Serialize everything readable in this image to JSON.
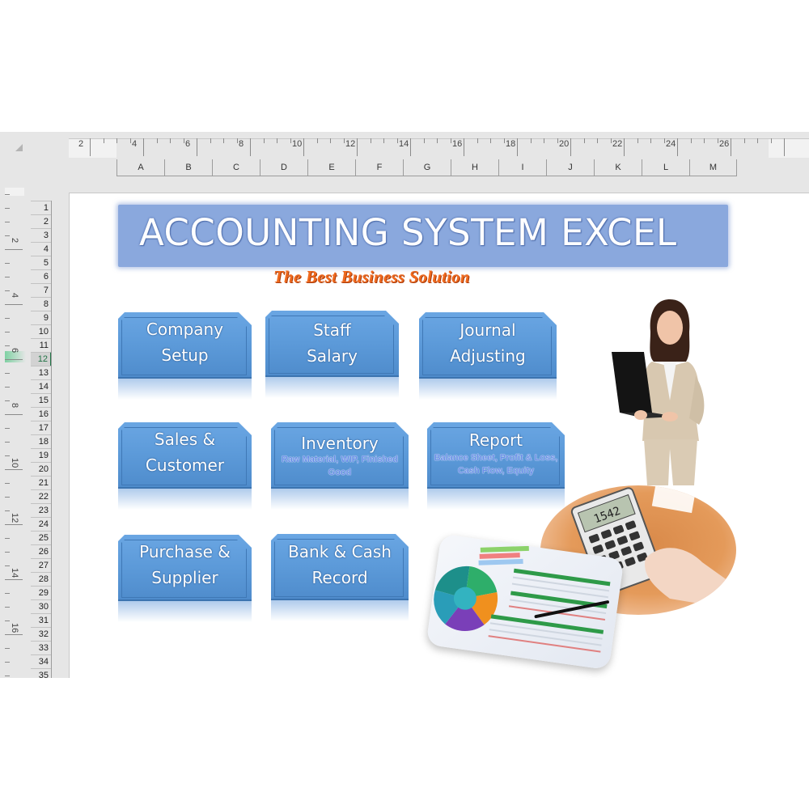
{
  "excel": {
    "ruler_h_labels": [
      "2",
      "4",
      "6",
      "8",
      "10",
      "12",
      "14",
      "16",
      "18",
      "20",
      "22",
      "24",
      "26"
    ],
    "ruler_v_labels": [
      "2",
      "4",
      "6",
      "8",
      "10",
      "12",
      "14",
      "16"
    ],
    "columns": [
      "A",
      "B",
      "C",
      "D",
      "E",
      "F",
      "G",
      "H",
      "I",
      "J",
      "K",
      "L",
      "M"
    ],
    "rows": [
      "1",
      "2",
      "3",
      "4",
      "5",
      "6",
      "7",
      "8",
      "9",
      "10",
      "11",
      "12",
      "13",
      "14",
      "15",
      "16",
      "17",
      "18",
      "19",
      "20",
      "21",
      "22",
      "23",
      "24",
      "25",
      "26",
      "27",
      "28",
      "29",
      "30",
      "31",
      "32",
      "33",
      "34",
      "35"
    ],
    "selected_row": "12",
    "accent_color": "#217346"
  },
  "banner": {
    "title": "ACCOUNTING SYSTEM EXCEL",
    "tagline": "The Best Business Solution"
  },
  "tiles": [
    {
      "line1": "Company",
      "line2": "Setup",
      "sub": ""
    },
    {
      "line1": "Staff",
      "line2": "Salary",
      "sub": ""
    },
    {
      "line1": "Journal",
      "line2": "Adjusting",
      "sub": ""
    },
    {
      "line1": "Sales &",
      "line2": "Customer",
      "sub": ""
    },
    {
      "line1": "Inventory",
      "line2": "",
      "sub": "Raw Material, WIP, Finished Good"
    },
    {
      "line1": "Report",
      "line2": "",
      "sub": "Balance Sheet, Profit & Loss, Cash Flow, Equity"
    },
    {
      "line1": "Purchase &",
      "line2": "Supplier",
      "sub": ""
    },
    {
      "line1": "Bank & Cash",
      "line2": "Record",
      "sub": ""
    }
  ],
  "images": {
    "person": "businesswoman-with-laptop",
    "calculator": "hand-using-calculator",
    "calculator_display": "1542",
    "report": "financial-report-with-pie-chart"
  },
  "colors": {
    "banner_bg": "#8aa8dd",
    "tile_bg": "#5c9ad9",
    "tagline": "#f06a1e"
  }
}
